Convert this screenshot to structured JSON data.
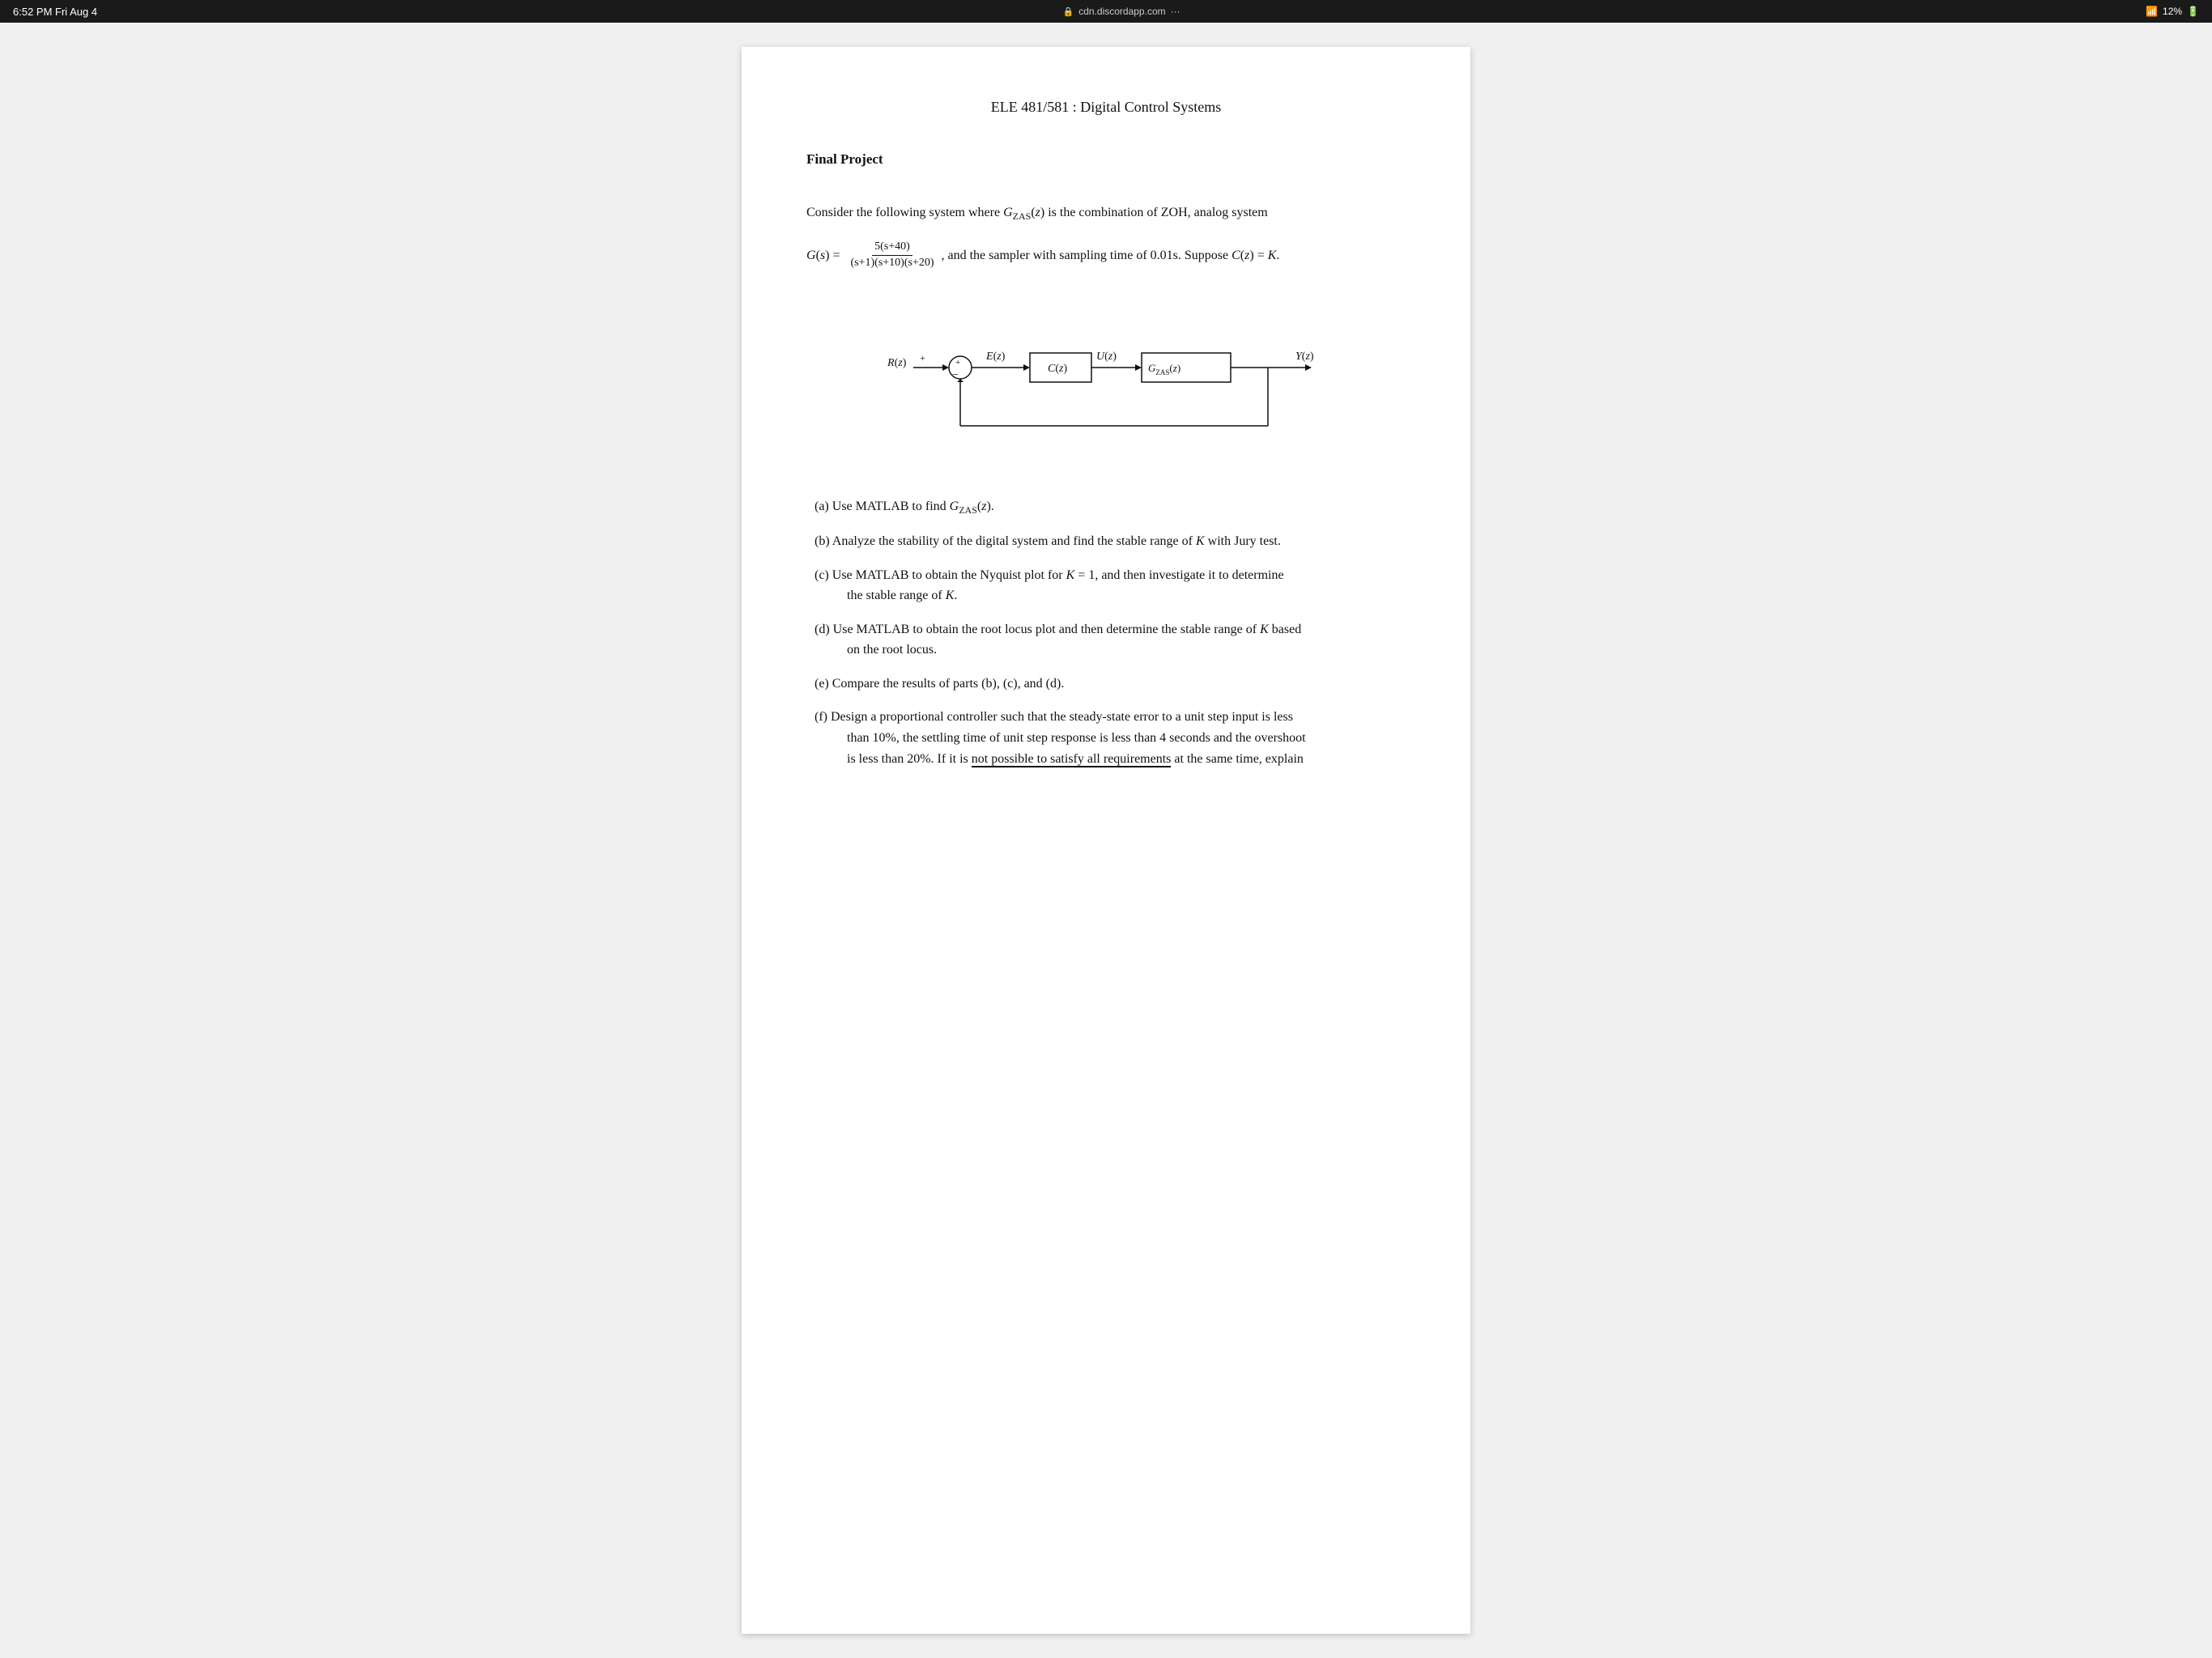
{
  "status_bar": {
    "time": "6:52 PM  Fri Aug 4",
    "url": "cdn.discordapp.com",
    "battery": "12%",
    "lock_icon": "🔒",
    "wifi_icon": "WiFi",
    "ellipsis": "···"
  },
  "document": {
    "title": "ELE 481/581 : Digital Control Systems",
    "subtitle": "Final Project",
    "intro": "Consider the following system where G",
    "g_zas_z": "ZAS",
    "intro_rest": "(z) is the combination of ZOH, analog system",
    "g_s_eq": "G(s) =",
    "numerator": "5(s+40)",
    "denominator": "(s+1)(s+10)(s+20)",
    "g_s_rest": ", and the sampler with sampling time of 0.01s. Suppose C(z) = K.",
    "parts": [
      {
        "label": "(a)",
        "text": "Use MATLAB to find G"
      },
      {
        "label": "(b)",
        "text": "Analyze the stability of the digital system and find the stable range of K with Jury test."
      },
      {
        "label": "(c)",
        "text": "Use MATLAB to obtain the Nyquist plot for K = 1, and then investigate it to determine the stable range of K."
      },
      {
        "label": "(d)",
        "text": "Use MATLAB to obtain the root locus plot and then determine the stable range of K based on the root locus."
      },
      {
        "label": "(e)",
        "text": "Compare the results of parts (b), (c), and (d)."
      },
      {
        "label": "(f)",
        "text": "Design a proportional controller such that the steady-state error to a unit step input is less than 10%, the settling time of unit step response is less than 4 seconds and the overshoot is less than 20%. If it is not possible to satisfy all requirements at the same time, explain"
      }
    ]
  }
}
